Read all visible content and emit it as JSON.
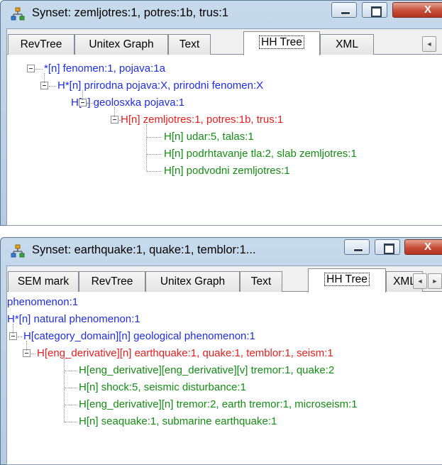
{
  "colors": {
    "blue": "#1e2de6",
    "red": "#ea1d1d",
    "green": "#148d14"
  },
  "window1": {
    "title": "Synset: zemljotres:1, potres:1b, trus:1",
    "close_glyph": "X",
    "tabs": [
      "RevTree",
      "Unitex Graph",
      "Text",
      "HH Tree",
      "XML"
    ],
    "active_tab": "HH Tree",
    "scroll_left_glyph": "◄",
    "tree": [
      {
        "text": "*[n] fenomen:1, pojava:1a",
        "color": "blue"
      },
      {
        "text": "H*[n] prirodna pojava:X, prirodni fenomen:X",
        "color": "blue"
      },
      {
        "text": "H[n] geolosxka pojava:1",
        "color": "blue"
      },
      {
        "text": "H[n] zemljotres:1, potres:1b, trus:1",
        "color": "red"
      },
      {
        "text": "H[n] udar:5, talas:1",
        "color": "green"
      },
      {
        "text": "H[n] podrhtavanje tla:2, slab zemljotres:1",
        "color": "green"
      },
      {
        "text": "H[n] podvodni zemljotres:1",
        "color": "green"
      }
    ]
  },
  "window2": {
    "title": "Synset: earthquake:1, quake:1, temblor:1...",
    "close_glyph": "X",
    "tabs": [
      "SEM mark",
      "RevTree",
      "Unitex Graph",
      "Text",
      "HH Tree",
      "XML"
    ],
    "active_tab": "HH Tree",
    "scroll_left_glyph": "◄",
    "scroll_right_glyph": "►",
    "tree": [
      {
        "text": "phenomenon:1",
        "color": "blue"
      },
      {
        "text": "H*[n] natural phenomenon:1",
        "color": "blue"
      },
      {
        "text": "H[category_domain][n] geological phenomenon:1",
        "color": "blue"
      },
      {
        "text": "H[eng_derivative][n] earthquake:1, quake:1, temblor:1, seism:1",
        "color": "red"
      },
      {
        "text": "H[eng_derivative][eng_derivative][v] tremor:1, quake:2",
        "color": "green"
      },
      {
        "text": "H[n] shock:5, seismic disturbance:1",
        "color": "green"
      },
      {
        "text": "H[eng_derivative][n] tremor:2, earth tremor:1, microseism:1",
        "color": "green"
      },
      {
        "text": "H[n] seaquake:1, submarine earthquake:1",
        "color": "green"
      }
    ]
  }
}
